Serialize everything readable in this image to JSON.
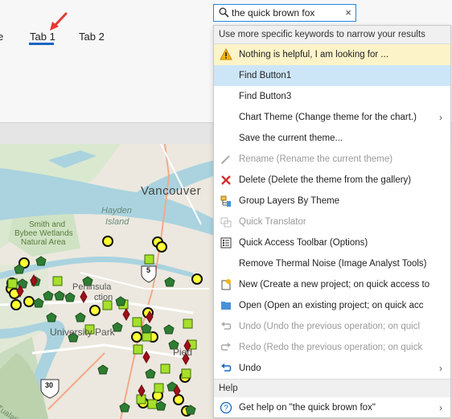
{
  "ribbon": {
    "tabs": [
      {
        "label": "e"
      },
      {
        "label": "Tab 1"
      },
      {
        "label": "Tab 2"
      }
    ]
  },
  "search": {
    "value": "the quick brown fox",
    "clear_label": "×"
  },
  "dropdown": {
    "header": "Use more specific keywords to narrow your results",
    "items": [
      {
        "label": "Nothing is helpful, I am looking for ...",
        "icon": "warning-icon"
      },
      {
        "label": "Find Button1",
        "icon": ""
      },
      {
        "label": "Find Button3",
        "icon": ""
      },
      {
        "label": "Chart Theme (Change theme for the chart.)",
        "icon": "",
        "submenu": "›"
      },
      {
        "label": "Save the current theme...",
        "icon": ""
      },
      {
        "label": "Rename (Rename the current theme)",
        "icon": "pencil-icon"
      },
      {
        "label": "Delete (Delete the theme from the gallery)",
        "icon": "delete-x-icon"
      },
      {
        "label": "Group Layers By Theme",
        "icon": "group-layers-icon"
      },
      {
        "label": "Quick Translator",
        "icon": "translator-icon"
      },
      {
        "label": "Quick Access Toolbar (Options)",
        "icon": "toolbar-options-icon"
      },
      {
        "label": "Remove Thermal Noise (Image Analyst Tools)",
        "icon": ""
      },
      {
        "label": "New (Create a new project; on quick access to",
        "icon": "new-project-icon"
      },
      {
        "label": "Open (Open an existing project; on quick acc",
        "icon": "open-folder-icon"
      },
      {
        "label": "Undo (Undo the previous operation; on quicl",
        "icon": "undo-icon"
      },
      {
        "label": "Redo (Redo the previous operation; on quick",
        "icon": "redo-icon"
      },
      {
        "label": "Undo",
        "icon": "undo-icon",
        "submenu": "›"
      }
    ],
    "help_section": "Help",
    "help_item": {
      "label": "Get help on  \"the quick brown fox\"",
      "icon": "help-icon",
      "submenu": "›"
    }
  },
  "map": {
    "labels": {
      "vancouver": "Vancouver",
      "hayden": "Hayden",
      "island": "Island",
      "smith1": "Smith and",
      "smith2": "Bybee Wetlands",
      "smith3": "Natural Area",
      "peninsula": "Peninsula",
      "ction": "ction",
      "university": "University Park",
      "piedmont": "Pied",
      "tualatin": "Tualatin",
      "hwy5": "5",
      "hwy30": "30"
    }
  }
}
